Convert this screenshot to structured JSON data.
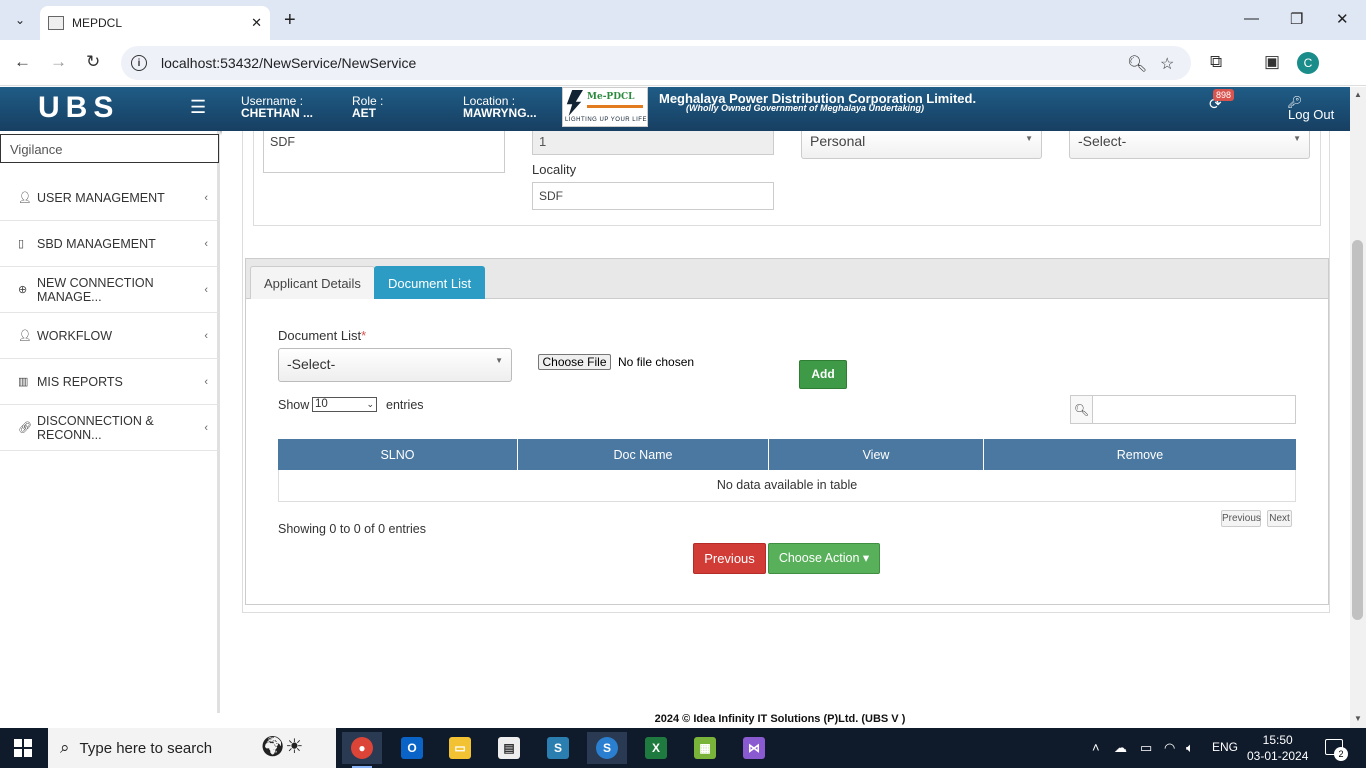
{
  "browser": {
    "tab_title": "MEPDCL",
    "tab_close": "✕",
    "new_tab": "+",
    "url": "localhost:53432/NewService/NewService",
    "profile_initial": "C"
  },
  "header": {
    "logo": "UBS",
    "username_label": "Username :",
    "username_value": "CHETHAN ...",
    "role_label": "Role :",
    "role_value": "AET",
    "location_label": "Location :",
    "location_value": "MAWRYNG...",
    "brand_logo_text": "Me-PDCL",
    "brand_tagline": "LIGHTING UP YOUR LIFE",
    "corp_name": "Meghalaya Power Distribution Corporation Limited.",
    "corp_sub": "(Wholly Owned Government of Meghalaya Undertaking)",
    "notif_count": "898",
    "logout": "Log Out"
  },
  "sidebar": {
    "search_value": "Vigilance",
    "items": [
      {
        "label": "USER MANAGEMENT",
        "icon": "user-icon"
      },
      {
        "label": "SBD MANAGEMENT",
        "icon": "mobile-icon"
      },
      {
        "label": "NEW CONNECTION MANAGE...",
        "icon": "plus-circle-icon"
      },
      {
        "label": "WORKFLOW",
        "icon": "user-icon"
      },
      {
        "label": "MIS REPORTS",
        "icon": "bar-chart-icon"
      },
      {
        "label": "DISCONNECTION & RECONN...",
        "icon": "link-icon"
      }
    ]
  },
  "form_top": {
    "address_value": "SDF",
    "disabled_value": "1",
    "locality_label": "Locality",
    "locality_value": "SDF",
    "select_category": "Personal",
    "select_other": "-Select-"
  },
  "tabs": {
    "applicant": "Applicant Details",
    "document": "Document List"
  },
  "document": {
    "label": "Document List",
    "required_mark": "*",
    "select_value": "-Select-",
    "choose_file": "Choose File",
    "no_file": "No file chosen",
    "add": "Add"
  },
  "table": {
    "show": "Show",
    "page_size": "10",
    "entries": "entries",
    "columns": [
      "SLNO",
      "Doc Name",
      "View",
      "Remove"
    ],
    "empty": "No data available in table",
    "showing": "Showing 0 to 0 of 0 entries",
    "prev_page": "Previous",
    "next_page": "Next"
  },
  "actions": {
    "previous": "Previous",
    "choose_action": "Choose Action ▾"
  },
  "footer": "2024 © Idea Infinity IT Solutions (P)Ltd. (UBS V )",
  "taskbar": {
    "search_placeholder": "Type here to search",
    "lang": "ENG",
    "time": "15:50",
    "date": "03-01-2024",
    "notif_count": "2"
  }
}
